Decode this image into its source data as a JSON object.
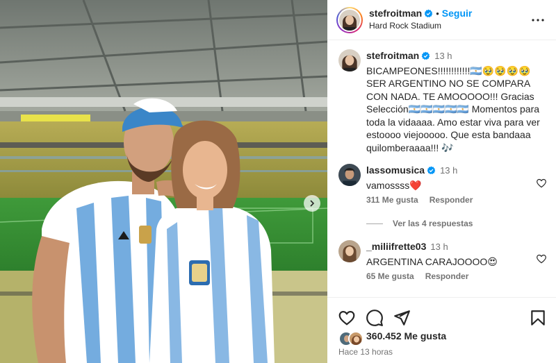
{
  "post": {
    "username": "stefroitman",
    "follow_label": "Seguir",
    "location": "Hard Rock Stadium",
    "caption_time": "13 h",
    "caption_text": "BICAMPEONES!!!!!!!!!!!!🇦🇷🥹🥹🥹🥹 SER ARGENTINO NO SE COMPARA CON NADA. TE AMOOOOO!!! Gracias Selección🇦🇷🇦🇷🇦🇷🇦🇷🇦🇷 Momentos para toda la vidaaaa. Amo estar viva para ver estoooo viejooooo. Que esta bandaaa quilomberaaaa!!! 🎶",
    "likes_label": "360.452 Me gusta",
    "posted_label": "Hace 13 horas"
  },
  "comments": [
    {
      "username": "lassomusica",
      "time": "13 h",
      "text": "vamossss❤️",
      "likes_label": "311 Me gusta",
      "reply_label": "Responder",
      "view_replies_label": "Ver las 4 respuestas"
    },
    {
      "username": "_miliifrette03",
      "time": "13 h",
      "text": "ARGENTINA CARAJOOOO😍",
      "likes_label": "65 Me gusta",
      "reply_label": "Responder"
    }
  ],
  "icons": {
    "more": "more-horizontal-icon",
    "like": "heart-icon",
    "comment": "comment-icon",
    "share": "paper-plane-icon",
    "save": "bookmark-icon",
    "verified": "verified-badge-icon",
    "carousel": "chevron-right-icon"
  },
  "colors": {
    "accent": "#0095f6",
    "text": "#262626",
    "muted": "#737373",
    "like_red": "#ed4956"
  }
}
